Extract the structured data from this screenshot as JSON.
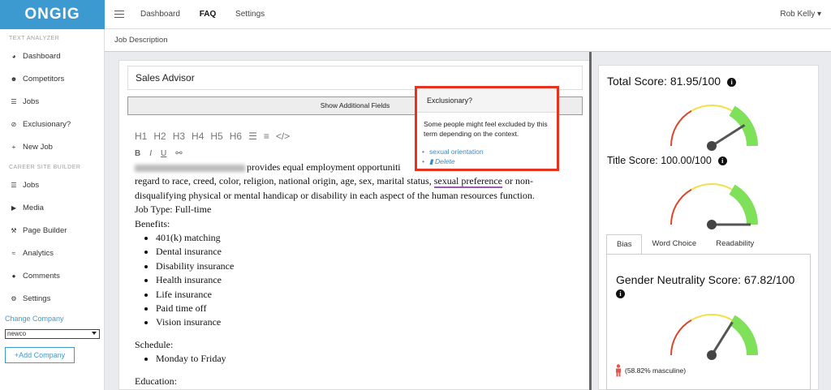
{
  "app": {
    "logo": "ONGIG"
  },
  "topnav": {
    "items": [
      "Dashboard",
      "FAQ",
      "Settings"
    ],
    "active": "FAQ",
    "user": "Rob Kelly ▾"
  },
  "sidebar": {
    "section1": "TEXT ANALYZER",
    "items1": [
      {
        "label": "Dashboard",
        "icon": "dashboard-icon"
      },
      {
        "label": "Competitors",
        "icon": "users-icon"
      },
      {
        "label": "Jobs",
        "icon": "list-icon"
      },
      {
        "label": "Exclusionary?",
        "icon": "ban-icon"
      },
      {
        "label": "New Job",
        "icon": "plus-icon"
      }
    ],
    "section2": "CAREER SITE BUILDER",
    "items2": [
      {
        "label": "Jobs",
        "icon": "list-icon"
      },
      {
        "label": "Media",
        "icon": "video-icon"
      },
      {
        "label": "Page Builder",
        "icon": "hammer-icon"
      },
      {
        "label": "Analytics",
        "icon": "chart-icon"
      },
      {
        "label": "Comments",
        "icon": "comment-icon"
      },
      {
        "label": "Settings",
        "icon": "gear-icon"
      }
    ],
    "change_company": "Change Company",
    "company_select": "newco",
    "add_company": "+Add Company"
  },
  "breadcrumb": "Job Description",
  "editor": {
    "title_value": "Sales Advisor",
    "show_fields": "Show Additional Fields",
    "toolbar": [
      "H1",
      "H2",
      "H3",
      "H4",
      "H5",
      "H6",
      "☰",
      "≡",
      "</>"
    ],
    "toolbar2": [
      "B",
      "I",
      "U",
      "⚯"
    ],
    "line1a": "provides equal employment opportuniti",
    "line1b": "t",
    "line2a": "regard to race, creed, color, religion, national origin, age, sex, marital status,",
    "flagged_term": "sexual preference",
    "line2b": "or non-",
    "line3": "disqualifying physical or mental handicap or disability in each aspect of the human resources function.",
    "job_type": "Job Type: Full-time",
    "benefits_heading": "Benefits:",
    "benefits": [
      "401(k) matching",
      "Dental insurance",
      "Disability insurance",
      "Health insurance",
      "Life insurance",
      "Paid time off",
      "Vision insurance"
    ],
    "schedule_heading": "Schedule:",
    "schedule": [
      "Monday to Friday"
    ],
    "education_heading": "Education:"
  },
  "popup": {
    "title": "Exclusionary?",
    "body": "Some people might feel excluded by this term depending on the context.",
    "suggestion": "sexual orientation",
    "delete": "Delete"
  },
  "scores": {
    "total": {
      "label": "Total Score: 81.95/100",
      "value": 81.95
    },
    "title": {
      "label": "Title Score: 100.00/100",
      "value": 100
    },
    "tabs": [
      "Bias",
      "Word Choice",
      "Readability"
    ],
    "active_tab": "Bias",
    "gender": {
      "label": "Gender Neutrality Score: 67.82/100",
      "value": 67.82
    },
    "masculine": "(58.82% masculine)"
  },
  "colors": {
    "brand": "#3d9ad1",
    "alert": "#e53320",
    "underline": "#9b59b6"
  }
}
